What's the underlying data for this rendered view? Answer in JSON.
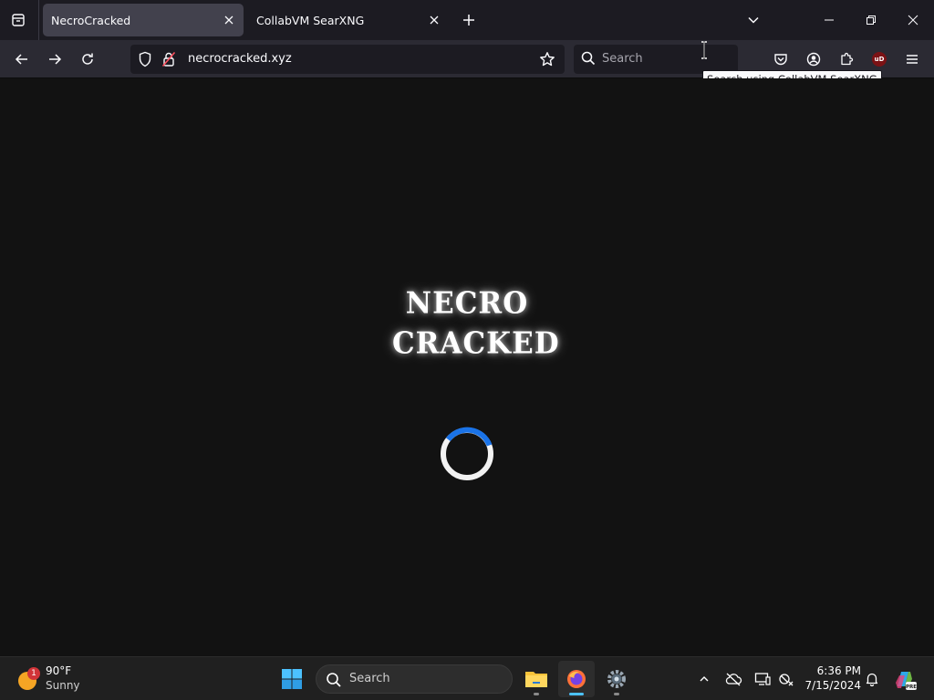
{
  "browser": {
    "tabs": [
      {
        "title": "NecroCracked",
        "active": true
      },
      {
        "title": "CollabVM SearXNG",
        "active": false
      }
    ],
    "url": "necrocracked.xyz",
    "search_placeholder": "Search",
    "tooltip": "Search using CollabVM SearXNG",
    "ublock_badge": "uD"
  },
  "page": {
    "logo_lines": [
      "NECRO",
      "CRACKED"
    ],
    "spinner_color": "#1a73e8"
  },
  "taskbar": {
    "weather": {
      "badge": "1",
      "temp": "90°F",
      "condition": "Sunny"
    },
    "search_placeholder": "Search",
    "clock": {
      "time": "6:36 PM",
      "date": "7/15/2024"
    }
  },
  "colors": {
    "tab_active": "#42414d",
    "navbar": "#2b2a33",
    "accent": "#4cc2ff"
  }
}
